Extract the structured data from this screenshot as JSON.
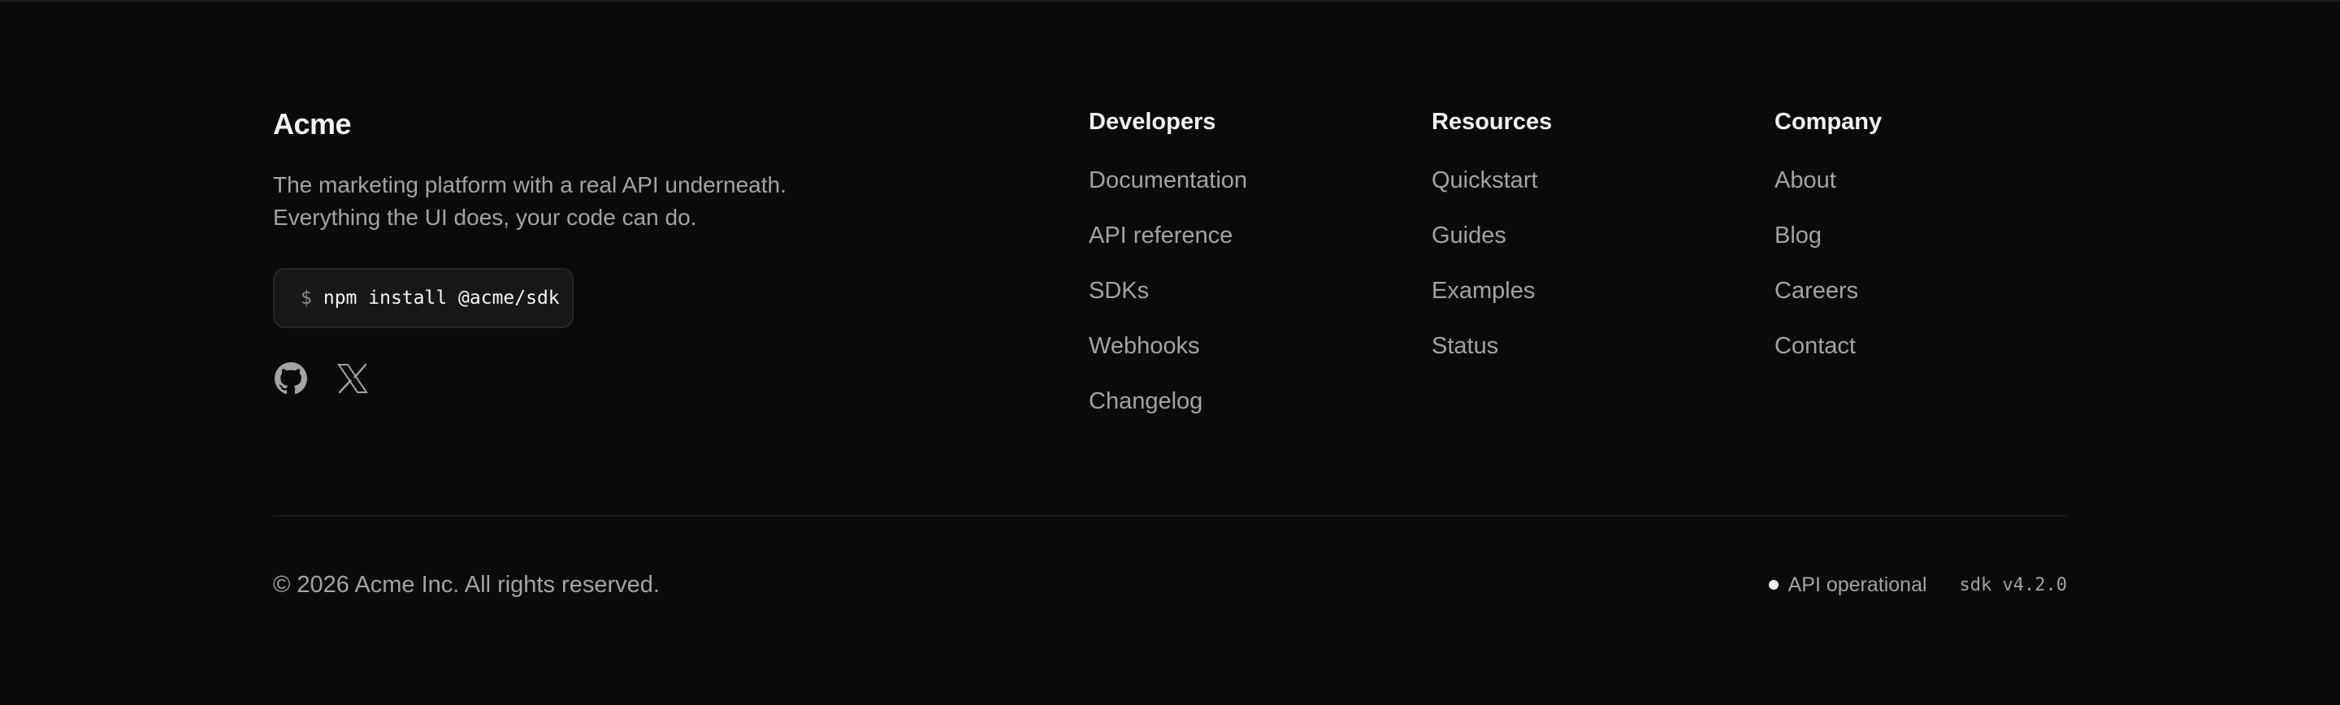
{
  "brand": {
    "name": "Acme",
    "tagline_line1": "The marketing platform with a real API underneath.",
    "tagline_line2": "Everything the UI does, your code can do.",
    "install_prompt": "$",
    "install_command": "npm install @acme/sdk"
  },
  "social": [
    {
      "icon": "github-icon"
    },
    {
      "icon": "x-icon"
    }
  ],
  "columns": {
    "developers": {
      "heading": "Developers",
      "links": [
        "Documentation",
        "API reference",
        "SDKs",
        "Webhooks",
        "Changelog"
      ]
    },
    "resources": {
      "heading": "Resources",
      "links": [
        "Quickstart",
        "Guides",
        "Examples",
        "Status"
      ]
    },
    "company": {
      "heading": "Company",
      "links": [
        "About",
        "Blog",
        "Careers",
        "Contact"
      ]
    }
  },
  "bottom": {
    "copyright": "© 2026 Acme Inc. All rights reserved.",
    "status": "API operational",
    "version": "sdk v4.2.0"
  },
  "colors": {
    "background": "#0a0a0a",
    "text_primary": "#f2f2f2",
    "text_muted": "#a3a3a3",
    "status_dot": "#ededed"
  }
}
